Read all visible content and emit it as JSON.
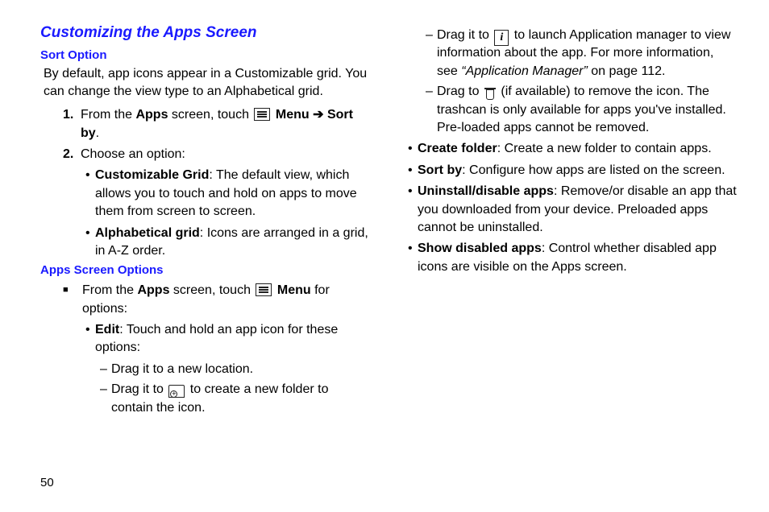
{
  "page_number": "50",
  "title": "Customizing the Apps Screen",
  "sort_option": {
    "heading": "Sort Option",
    "intro": "By default, app icons appear in a Customizable grid. You can change the view type to an Alphabetical grid.",
    "step1_pre": "From the ",
    "step1_apps": "Apps",
    "step1_mid": " screen, touch ",
    "step1_menu": "Menu",
    "step1_arrow": " ➔ ",
    "step1_sortby": "Sort by",
    "step1_end": ".",
    "step2": "Choose an option:",
    "opt1_label": "Customizable Grid",
    "opt1_text": ": The default view, which allows you to touch and hold on apps to move them from screen to screen.",
    "opt2_label": "Alphabetical grid",
    "opt2_text": ": Icons are arranged in a grid, in A-Z order."
  },
  "apps_options": {
    "heading": "Apps Screen Options",
    "intro_pre": "From the ",
    "intro_apps": "Apps",
    "intro_mid": " screen, touch ",
    "intro_menu": "Menu",
    "intro_end": " for options:",
    "edit_label": "Edit",
    "edit_text": ": Touch and hold an app icon for these options:",
    "d1": "Drag it to a new location.",
    "d2_pre": "Drag it to ",
    "d2_post": " to create a new folder to contain the icon.",
    "d3_pre": "Drag it to ",
    "d3_post": " to launch Application manager to view information about the app. For more information, see ",
    "d3_ref": "“Application Manager”",
    "d3_page": " on page 112.",
    "d4_pre": "Drag to ",
    "d4_post": " (if available) to remove the icon. The trashcan is only available for apps you've installed. Pre-loaded apps cannot be removed.",
    "create_label": "Create folder",
    "create_text": ": Create a new folder to contain apps.",
    "sortby_label": "Sort by",
    "sortby_text": ": Configure how apps are listed on the screen.",
    "uninstall_label": "Uninstall/disable apps",
    "uninstall_text": ": Remove/or disable an app that you downloaded from your device. Preloaded apps cannot be uninstalled.",
    "showdis_label": "Show disabled apps",
    "showdis_text": ": Control whether disabled app icons are visible on the Apps screen."
  }
}
